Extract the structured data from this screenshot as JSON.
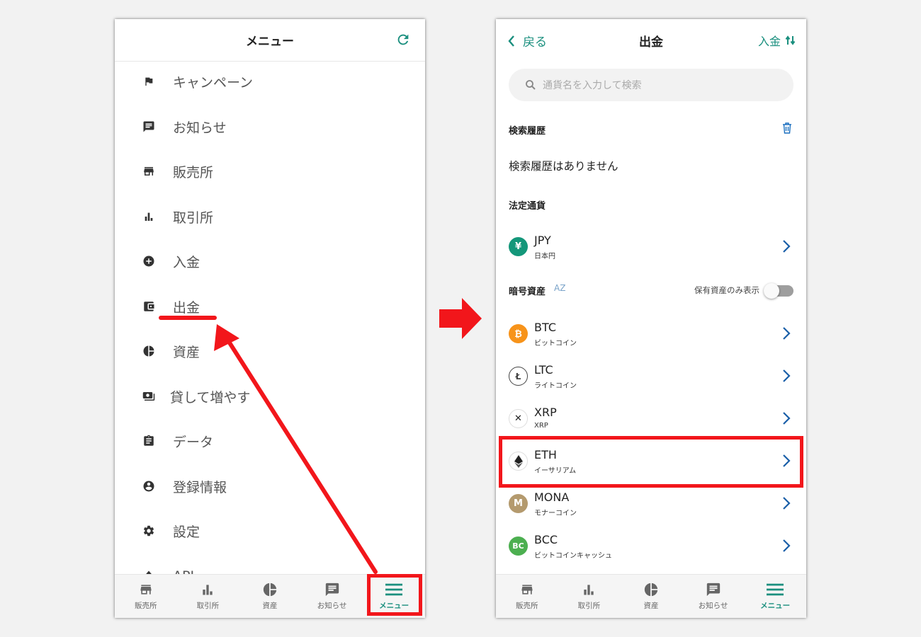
{
  "left": {
    "header": {
      "title": "メニュー",
      "refresh_icon": "refresh-icon"
    },
    "menu_items": [
      {
        "label": "キャンペーン",
        "icon": "flag-icon"
      },
      {
        "label": "お知らせ",
        "icon": "message-icon"
      },
      {
        "label": "販売所",
        "icon": "store-icon"
      },
      {
        "label": "取引所",
        "icon": "bar-chart-icon"
      },
      {
        "label": "入金",
        "icon": "plus-circle-icon"
      },
      {
        "label": "出金",
        "icon": "wallet-icon"
      },
      {
        "label": "資産",
        "icon": "pie-chart-icon"
      },
      {
        "label": "貸して増やす",
        "icon": "lend-icon"
      },
      {
        "label": "データ",
        "icon": "clipboard-icon"
      },
      {
        "label": "登録情報",
        "icon": "account-icon"
      },
      {
        "label": "設定",
        "icon": "gear-icon"
      },
      {
        "label": "API",
        "icon": "api-icon"
      }
    ]
  },
  "bottom_nav": [
    {
      "label": "販売所",
      "icon": "store-icon"
    },
    {
      "label": "取引所",
      "icon": "bar-chart-icon"
    },
    {
      "label": "資産",
      "icon": "pie-chart-icon"
    },
    {
      "label": "お知らせ",
      "icon": "message-icon"
    },
    {
      "label": "メニュー",
      "icon": "hamburger-icon"
    }
  ],
  "right": {
    "header": {
      "back_label": "戻る",
      "title": "出金",
      "deposit_label": "入金"
    },
    "search": {
      "placeholder": "通貨名を入力して検索"
    },
    "history": {
      "title": "検索履歴",
      "empty_text": "検索履歴はありません"
    },
    "fiat": {
      "title": "法定通貨",
      "items": [
        {
          "symbol": "JPY",
          "name": "日本円",
          "color": "#14977a"
        }
      ]
    },
    "crypto": {
      "title": "暗号資産",
      "sort_label": "AZ",
      "toggle_label": "保有資産のみ表示",
      "items": [
        {
          "symbol": "BTC",
          "name": "ビットコイン",
          "color": "#f7931a"
        },
        {
          "symbol": "LTC",
          "name": "ライトコイン",
          "color": "#ffffff"
        },
        {
          "symbol": "XRP",
          "name": "XRP",
          "color": "#ffffff"
        },
        {
          "symbol": "ETH",
          "name": "イーサリアム",
          "color": "#ffffff"
        },
        {
          "symbol": "MONA",
          "name": "モナーコイン",
          "color": "#b49a6e"
        },
        {
          "symbol": "BCC",
          "name": "ビットコインキャッシュ",
          "color": "#4caf50"
        }
      ]
    }
  },
  "colors": {
    "accent": "#1a8f7e",
    "annotation": "#f2161b"
  }
}
